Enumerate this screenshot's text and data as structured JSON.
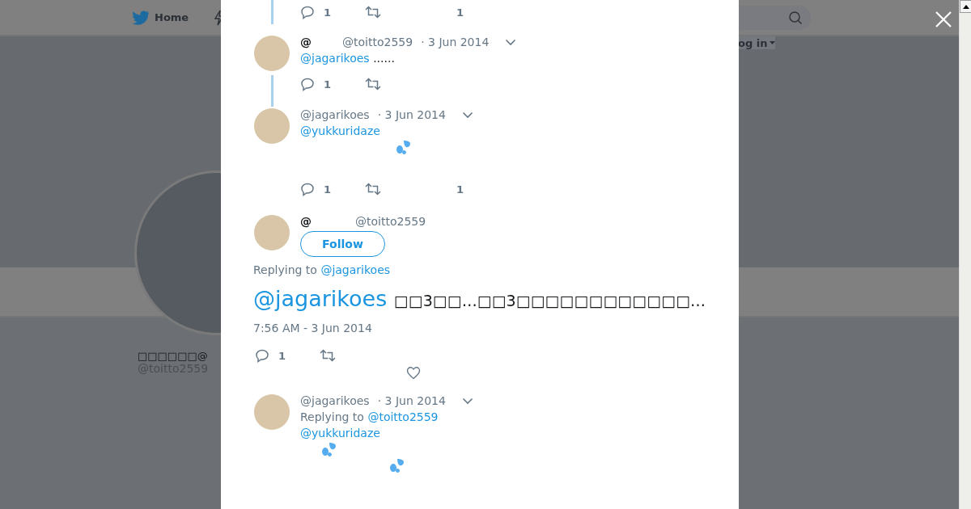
{
  "nav": {
    "home": "Home",
    "login": "og in"
  },
  "profile": {
    "name": "□□□□□□@",
    "handle": "@toitto2559"
  },
  "thread": [
    {
      "kind": "actions",
      "actions": {
        "replies": "1",
        "likes": "1"
      }
    },
    {
      "kind": "tweet",
      "name": "@",
      "handle": "@toitto2559",
      "date": "· 3 Jun 2014",
      "mention": "@jagarikoes",
      "text": "......",
      "actions": {
        "replies": "1"
      }
    },
    {
      "kind": "tweet",
      "handle": "@jagarikoes",
      "date": "· 3 Jun 2014",
      "mention": "@yukkuridaze",
      "emojis": [
        {
          "kind": "sweat"
        }
      ],
      "actions": {
        "replies": "1",
        "likes": "1"
      }
    },
    {
      "kind": "focus",
      "name": "@",
      "handle": "@toitto2559",
      "follow": "Follow",
      "replying_label": "Replying to",
      "replying_to": "@jagarikoes",
      "mention": "@jagarikoes",
      "text": "□□3□□…□□3□□□□□□□□□□□□…",
      "timestamp": "7:56 AM - 3 Jun 2014",
      "actions": {
        "replies": "1"
      }
    },
    {
      "kind": "tweet",
      "handle": "@jagarikoes",
      "date": "· 3 Jun 2014",
      "replying_label": "Replying to",
      "replying_to": "@toitto2559",
      "mention": "@yukkuridaze",
      "emojis": [
        {
          "kind": "sweat"
        },
        {
          "kind": "sweat"
        }
      ]
    }
  ]
}
